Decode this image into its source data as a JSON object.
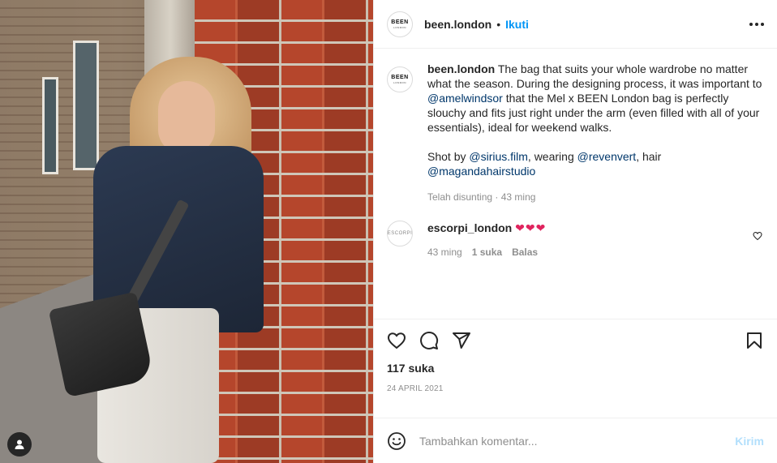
{
  "post": {
    "username": "been.london",
    "follow_label": "Ikuti",
    "avatar_text": "BEEN",
    "avatar_subtext": "LONDON",
    "caption": {
      "username": "been.london",
      "part1": " The bag that suits your whole wardrobe no matter what the season. During the designing process, it was important to ",
      "mention1": "@amelwindsor",
      "part2": " that the Mel x BEEN London bag is perfectly slouchy and fits just right under the arm (even filled with all of your essentials), ideal for weekend walks.",
      "part3": "Shot by ",
      "mention2": "@sirius.film",
      "part4": ", wearing ",
      "mention3": "@revenvert",
      "part5": ", hair ",
      "mention4": "@magandahairstudio"
    },
    "caption_meta": "Telah disunting · 43 ming",
    "comments": [
      {
        "username": "escorpi_london",
        "avatar_text": "ESCORPI",
        "text": "❤❤❤",
        "age": "43 ming",
        "likes": "1 suka",
        "reply_label": "Balas"
      }
    ],
    "likes": "117 suka",
    "date": "24 APRIL 2021",
    "add_comment": {
      "placeholder": "Tambahkan komentar...",
      "post_label": "Kirim"
    }
  },
  "icons": {
    "like": "heart-icon",
    "comment": "comment-icon",
    "share": "send-icon",
    "save": "bookmark-icon",
    "emoji": "emoji-icon",
    "more": "more-icon",
    "user_tag": "user-icon"
  },
  "colors": {
    "link": "#0095f6",
    "mention": "#00376b",
    "muted": "#8e8e8e",
    "heart": "#e0245e",
    "post_disabled": "#b2dffc"
  }
}
